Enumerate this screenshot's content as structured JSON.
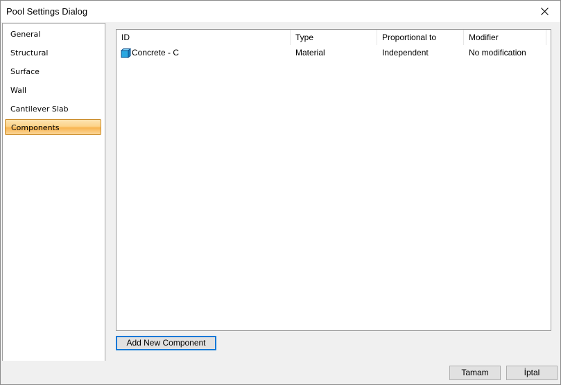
{
  "window": {
    "title": "Pool Settings Dialog"
  },
  "nav": {
    "items": [
      {
        "label": "General"
      },
      {
        "label": "Structural"
      },
      {
        "label": "Surface"
      },
      {
        "label": "Wall"
      },
      {
        "label": "Cantilever Slab"
      },
      {
        "label": "Components",
        "selected": true
      }
    ]
  },
  "grid": {
    "columns": [
      "ID",
      "Type",
      "Proportional to",
      "Modifier"
    ],
    "rows": [
      {
        "icon": "material-cube-icon",
        "id": "Concrete - C",
        "type": "Material",
        "proportional_to": "Independent",
        "modifier": "No modification"
      }
    ]
  },
  "buttons": {
    "add_component": "Add New Component",
    "ok": "Tamam",
    "cancel": "İptal"
  },
  "colors": {
    "selection_gradient_top": "#fde5b2",
    "selection_gradient_bottom": "#f8b551",
    "focus_border": "#0078d7",
    "icon_blue": "#29a7e1"
  }
}
